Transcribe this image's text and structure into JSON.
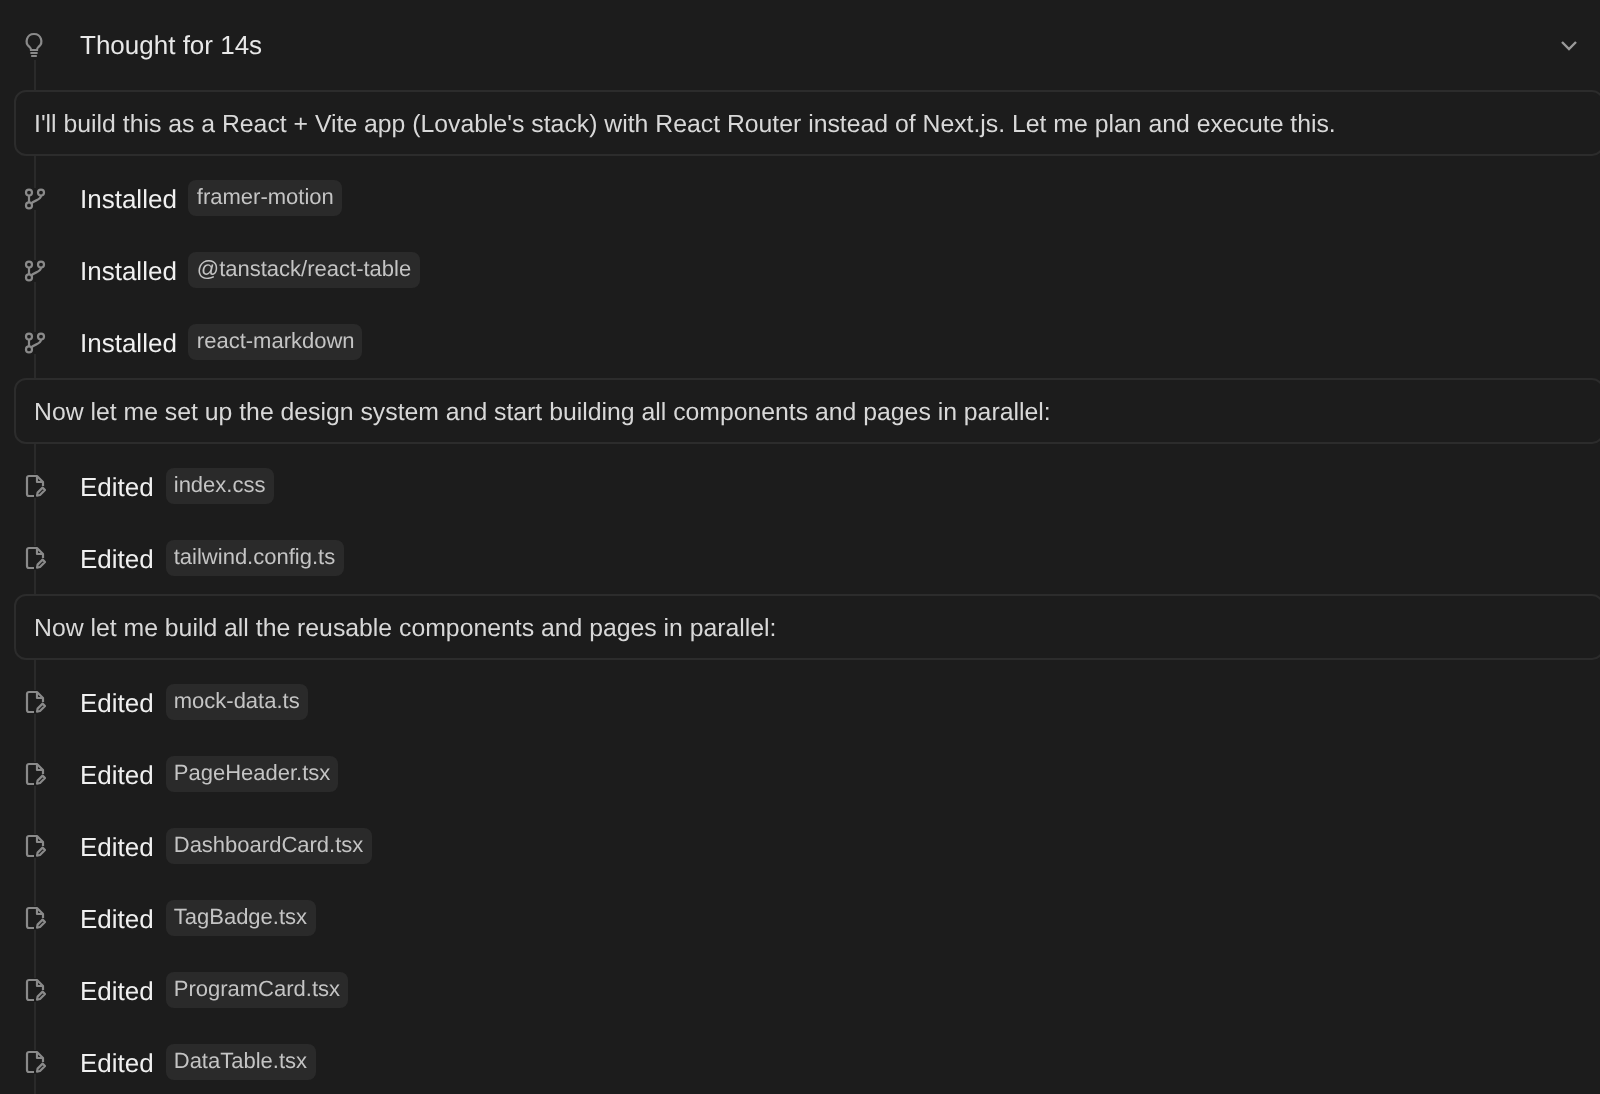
{
  "thought": {
    "label": "Thought for 14s",
    "expanded": false
  },
  "items": [
    {
      "kind": "message",
      "text": "I'll build this as a React + Vite app (Lovable's stack) with React Router instead of Next.js. Let me plan and execute this."
    },
    {
      "kind": "install",
      "verb": "Installed",
      "file": "framer-motion"
    },
    {
      "kind": "install",
      "verb": "Installed",
      "file": "@tanstack/react-table"
    },
    {
      "kind": "install",
      "verb": "Installed",
      "file": "react-markdown"
    },
    {
      "kind": "message",
      "text": "Now let me set up the design system and start building all components and pages in parallel:"
    },
    {
      "kind": "edit",
      "verb": "Edited",
      "file": "index.css"
    },
    {
      "kind": "edit",
      "verb": "Edited",
      "file": "tailwind.config.ts"
    },
    {
      "kind": "message",
      "text": "Now let me build all the reusable components and pages in parallel:"
    },
    {
      "kind": "edit",
      "verb": "Edited",
      "file": "mock-data.ts"
    },
    {
      "kind": "edit",
      "verb": "Edited",
      "file": "PageHeader.tsx"
    },
    {
      "kind": "edit",
      "verb": "Edited",
      "file": "DashboardCard.tsx"
    },
    {
      "kind": "edit",
      "verb": "Edited",
      "file": "TagBadge.tsx"
    },
    {
      "kind": "edit",
      "verb": "Edited",
      "file": "ProgramCard.tsx"
    },
    {
      "kind": "edit",
      "verb": "Edited",
      "file": "DataTable.tsx"
    }
  ]
}
